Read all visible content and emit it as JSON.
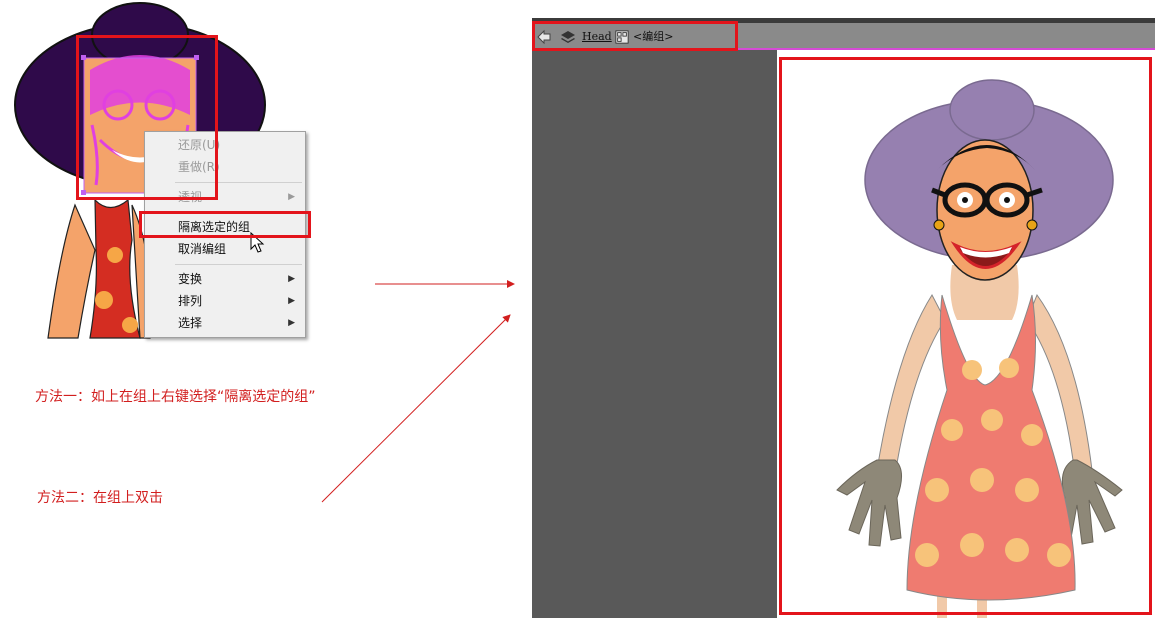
{
  "context_menu": {
    "items": [
      {
        "label": "还原(U)",
        "enabled": false,
        "submenu": false
      },
      {
        "label": "重做(R)",
        "enabled": false,
        "submenu": false
      },
      {
        "label": "透视",
        "enabled": false,
        "submenu": true
      },
      {
        "label": "隔离选定的组",
        "enabled": true,
        "submenu": false
      },
      {
        "label": "取消编组",
        "enabled": true,
        "submenu": false
      },
      {
        "label": "变换",
        "enabled": true,
        "submenu": true
      },
      {
        "label": "排列",
        "enabled": true,
        "submenu": true
      },
      {
        "label": "选择",
        "enabled": true,
        "submenu": true
      }
    ]
  },
  "annotations": {
    "method1": "方法一：如上在组上右键选择“隔离选定的组”",
    "method2": "方法二：在组上双击"
  },
  "isolation_bar": {
    "layer_name": "Head",
    "group_label": "<编组>",
    "icons": [
      "back-arrow-icon",
      "layers-icon",
      "group-icon"
    ]
  },
  "colors": {
    "highlight": "#e3141b",
    "annotation": "#d21f1f",
    "hat": "#2f0a4a",
    "hat_isolated": "#9680b0",
    "dress": "#e0463c",
    "dress_isolated": "#ef7b70",
    "skin": "#f4a36a",
    "glove": "#8e8878",
    "selection": "#e040e0"
  }
}
